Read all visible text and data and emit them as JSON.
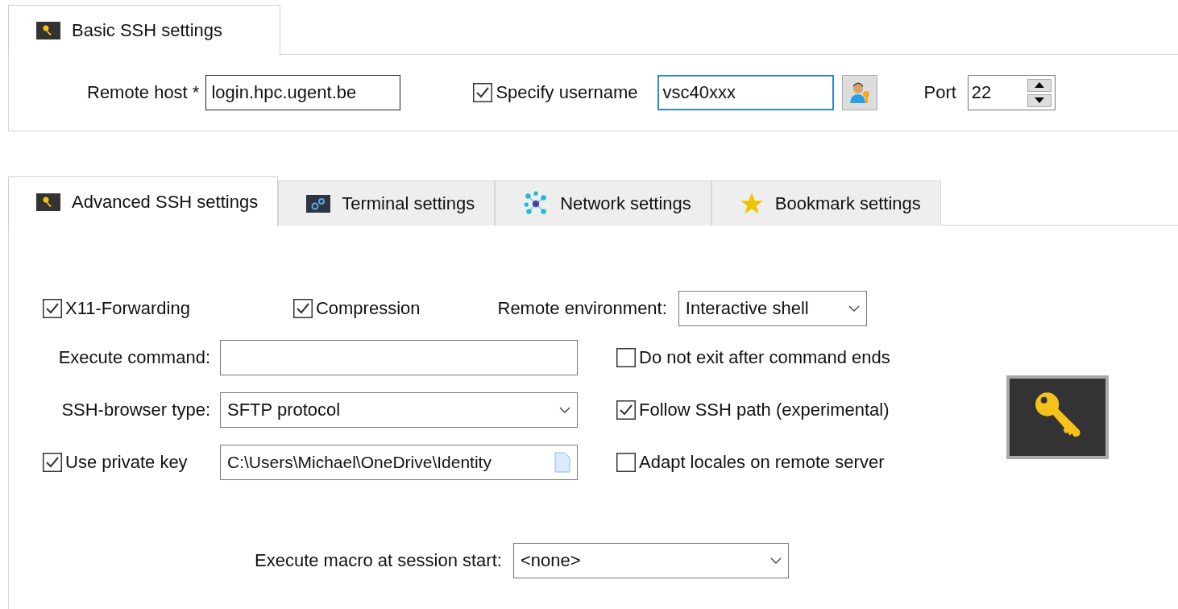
{
  "basic_tab": {
    "label": "Basic SSH settings",
    "selected": true
  },
  "basic": {
    "remote_host": {
      "label": "Remote host *",
      "value": "login.hpc.ugent.be"
    },
    "specify_username": {
      "label": "Specify username",
      "checked": true
    },
    "username": {
      "value": "vsc40xxx",
      "focused": true
    },
    "port": {
      "label": "Port",
      "value": "22"
    }
  },
  "tabs": [
    {
      "label": "Advanced SSH settings",
      "selected": true,
      "kind": "key"
    },
    {
      "label": "Terminal settings",
      "selected": false,
      "kind": "terminal"
    },
    {
      "label": "Network settings",
      "selected": false,
      "kind": "network"
    },
    {
      "label": "Bookmark settings",
      "selected": false,
      "kind": "bookmark"
    }
  ],
  "advanced": {
    "x11_forwarding": {
      "label": "X11-Forwarding",
      "checked": true
    },
    "compression": {
      "label": "Compression",
      "checked": true
    },
    "remote_environment": {
      "label": "Remote environment:",
      "value": "Interactive shell"
    },
    "execute_command": {
      "label": "Execute command:"
    },
    "do_not_exit": {
      "label": "Do not exit after command ends",
      "checked": false
    },
    "ssh_browser_type": {
      "label": "SSH-browser type:",
      "value": "SFTP protocol"
    },
    "follow_ssh_path": {
      "label": "Follow SSH path (experimental)",
      "checked": true
    },
    "private_key": {
      "label": "Use private key",
      "checked": true,
      "value": "C:\\Users\\Michael\\OneDrive\\Identity"
    },
    "adapt_locales": {
      "label": "Adapt locales on remote server",
      "checked": false
    },
    "macro": {
      "label": "Execute macro at session start:",
      "value": "<none>"
    }
  }
}
